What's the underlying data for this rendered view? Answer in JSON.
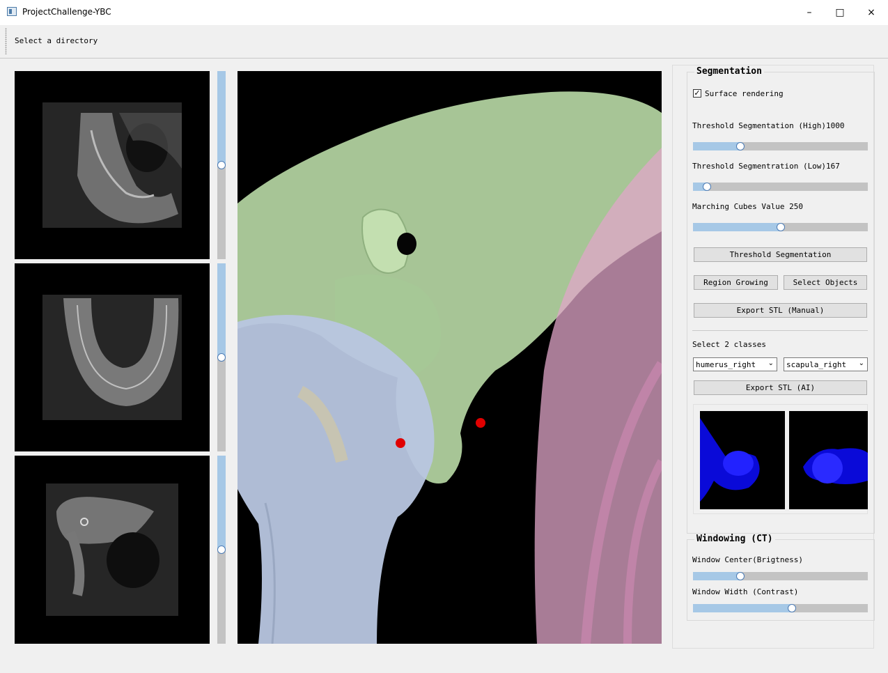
{
  "window": {
    "title": "ProjectChallenge-YBC"
  },
  "toolbar": {
    "select_directory": "Select a directory"
  },
  "segmentation": {
    "title": "Segmentation",
    "surface_rendering_label": "Surface rendering",
    "surface_rendering_checked": true,
    "threshold_high_label": "Threshold Segmentation (High)1000",
    "threshold_high_level": 0.26,
    "threshold_low_label": "Threshold Segmentration (Low)167",
    "threshold_low_level": 0.06,
    "marching_cubes_label": "Marching Cubes Value 250",
    "marching_cubes_level": 0.5,
    "threshold_button": "Threshold Segmentation",
    "region_growing_button": "Region Growing",
    "select_objects_button": "Select Objects",
    "export_manual_button": "Export STL (Manual)",
    "select_classes_label": "Select 2 classes",
    "class1": "humerus_right",
    "class2": "scapula_right",
    "export_ai_button": "Export STL (AI)"
  },
  "windowing": {
    "title": "Windowing (CT)",
    "center_label": "Window Center(Brigtness)",
    "center_level": 0.26,
    "width_label": "Window Width (Contrast)",
    "width_level": 0.57
  },
  "slice_sliders": {
    "axial_level": 0.5,
    "coronal_level": 0.5,
    "sagittal_level": 0.5
  },
  "icons": {
    "close": "×",
    "maximize": "□",
    "minimize": "–",
    "check": "✓",
    "dropdown": "⌄"
  },
  "colors": {
    "accent": "#a6c8e6",
    "handle_border": "#4b7bb5",
    "bone_scapula": "#b5d6a3",
    "bone_humerus": "#b8c6e0",
    "ribs": "#e0a6c8",
    "marker": "#e00000"
  }
}
